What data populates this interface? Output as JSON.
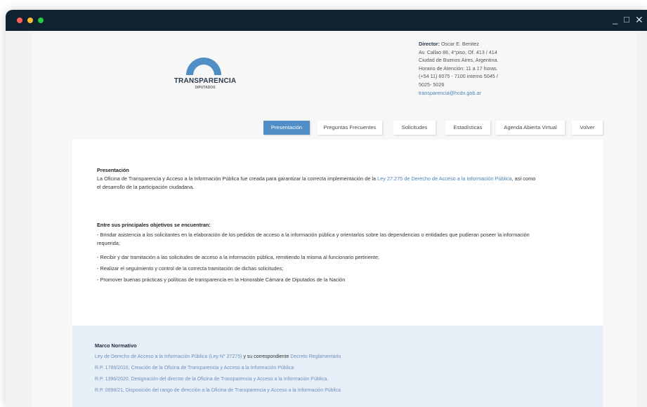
{
  "window": {
    "controls": {
      "minimize": "_",
      "maximize": "□",
      "close": "✕"
    }
  },
  "logo": {
    "title": "TRANSPARENCIA",
    "subtitle": "DIPUTADOS",
    "arc_color": "#4f8fc6"
  },
  "contact": {
    "director_label": "Director:",
    "director_name": "Oscar E. Benitez",
    "lines": [
      "Av. Callao 86, 4°piso, Of. 413 / 414",
      "Ciudad de Buenos Aires, Argentina.",
      "Horario de Atención: 11 a 17 horas.",
      "(+54 11) 6075 - 7100 interno 5045 /",
      "5025- 5026"
    ],
    "email": "transparencia@hcdn.gob.ar"
  },
  "nav": [
    {
      "label": "Presentación",
      "active": true
    },
    {
      "label": "Preguntas Frecuentes",
      "active": false
    },
    {
      "label": "Solicitudes",
      "active": false
    },
    {
      "label": "Estadísticas",
      "active": false
    },
    {
      "label": "Agenda Abierta Virtual",
      "active": false
    },
    {
      "label": "Volver",
      "active": false
    }
  ],
  "presentacion": {
    "heading": "Presentación",
    "p1_before": "La Oficina de Transparencia y Acceso a la Información Pública fue creada para garantizar la correcta implementación de la ",
    "p1_link": "Ley 27.275 de Derecho de Acceso a la Información Pública",
    "p1_after": ", así como",
    "p1_line2": "el desarrollo de la participación ciudadana.",
    "objectives_heading": "Entre sus principales objetivos se encuentran:",
    "obj1_line1": "- Brindar asistencia a los solicitantes en la elaboración de los pedidos de acceso a la información pública y orientarlos sobre las dependencias o entidades que pudieran poseer la información",
    "obj1_line2": "requerida;",
    "obj2": "- Recibir y dar tramitación a las solicitudes de acceso a la información pública, remitiendo la misma al funcionario pertinente;",
    "obj3": "- Realizar el seguimiento y control de la correcta tramitación de dichas solicitudes;",
    "obj4": "- Promover buenas prácticas y políticas de transparencia en la Honorable Cámara de Diputados de la Nación"
  },
  "marco": {
    "title": "Marco Normativo",
    "line1_link": "Ley de Derecho de Acceso a la Información Pública (Ley N° 27275)",
    "line1_mid": " y su correspondiente ",
    "line1_link2": "Decreto Reglamentario",
    "line2": "R.P. 1786/2016, Creación de la Oficina de Transparencia y Acceso a la Información Pública",
    "line3": "R.P. 1396/2020. Designación del director de la Oficina de Transparencia y Acceso a la Información Pública.",
    "line4": "R.P. 0998/21, Disposición del rango de dirección a la Oficina de Transparencia y Acceso a la Información Pública"
  }
}
